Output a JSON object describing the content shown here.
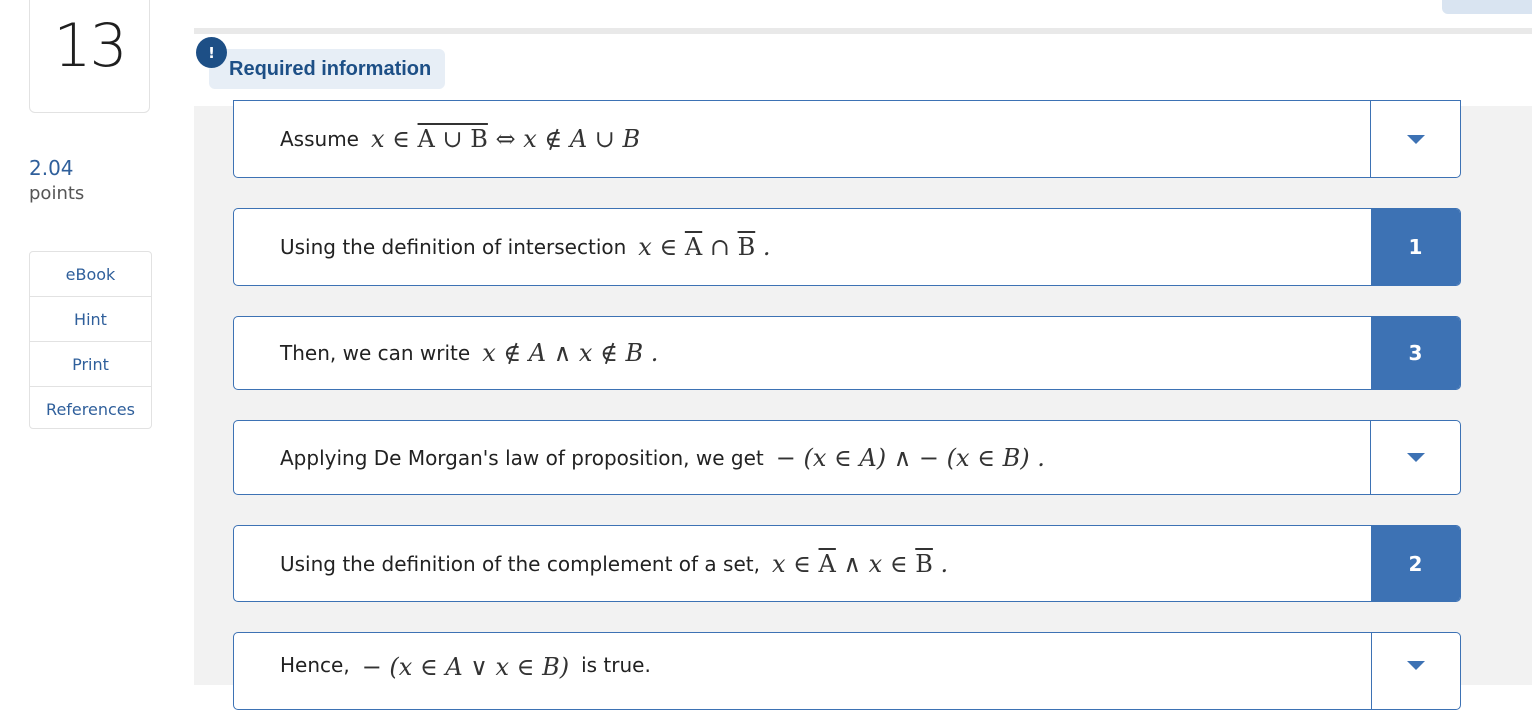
{
  "question": {
    "number": "13",
    "points_value": "2.04",
    "points_label": "points"
  },
  "side_links": [
    "eBook",
    "Hint",
    "Print",
    "References"
  ],
  "alert": {
    "icon_glyph": "!",
    "label": "Required information"
  },
  "rows": [
    {
      "text": "Assume",
      "math": "x ∈ A ∪ B ⇔ x ∉ A ∪ B",
      "control": "dropdown",
      "value": ""
    },
    {
      "text": "Using the definition of intersection",
      "math": "x ∈ A ∩ B .",
      "control": "number",
      "value": "1"
    },
    {
      "text": "Then, we can write",
      "math": "x ∉ A ∧ x ∉ B .",
      "control": "number",
      "value": "3"
    },
    {
      "text": "Applying De Morgan's law of proposition, we get",
      "math": "− (x ∈ A) ∧ − (x ∈ B) .",
      "control": "dropdown",
      "value": ""
    },
    {
      "text": "Using the definition of the complement of a set,",
      "math": "x ∈ A ∧ x ∈ B .",
      "control": "number",
      "value": "2"
    },
    {
      "text": "Hence,",
      "math": "− (x ∈ A ∨ x ∈ B)",
      "suffix": "is true.",
      "control": "dropdown",
      "value": ""
    }
  ],
  "colors": {
    "accent": "#3d72b4",
    "alert": "#1d4f86",
    "link": "#2f5f9b"
  }
}
